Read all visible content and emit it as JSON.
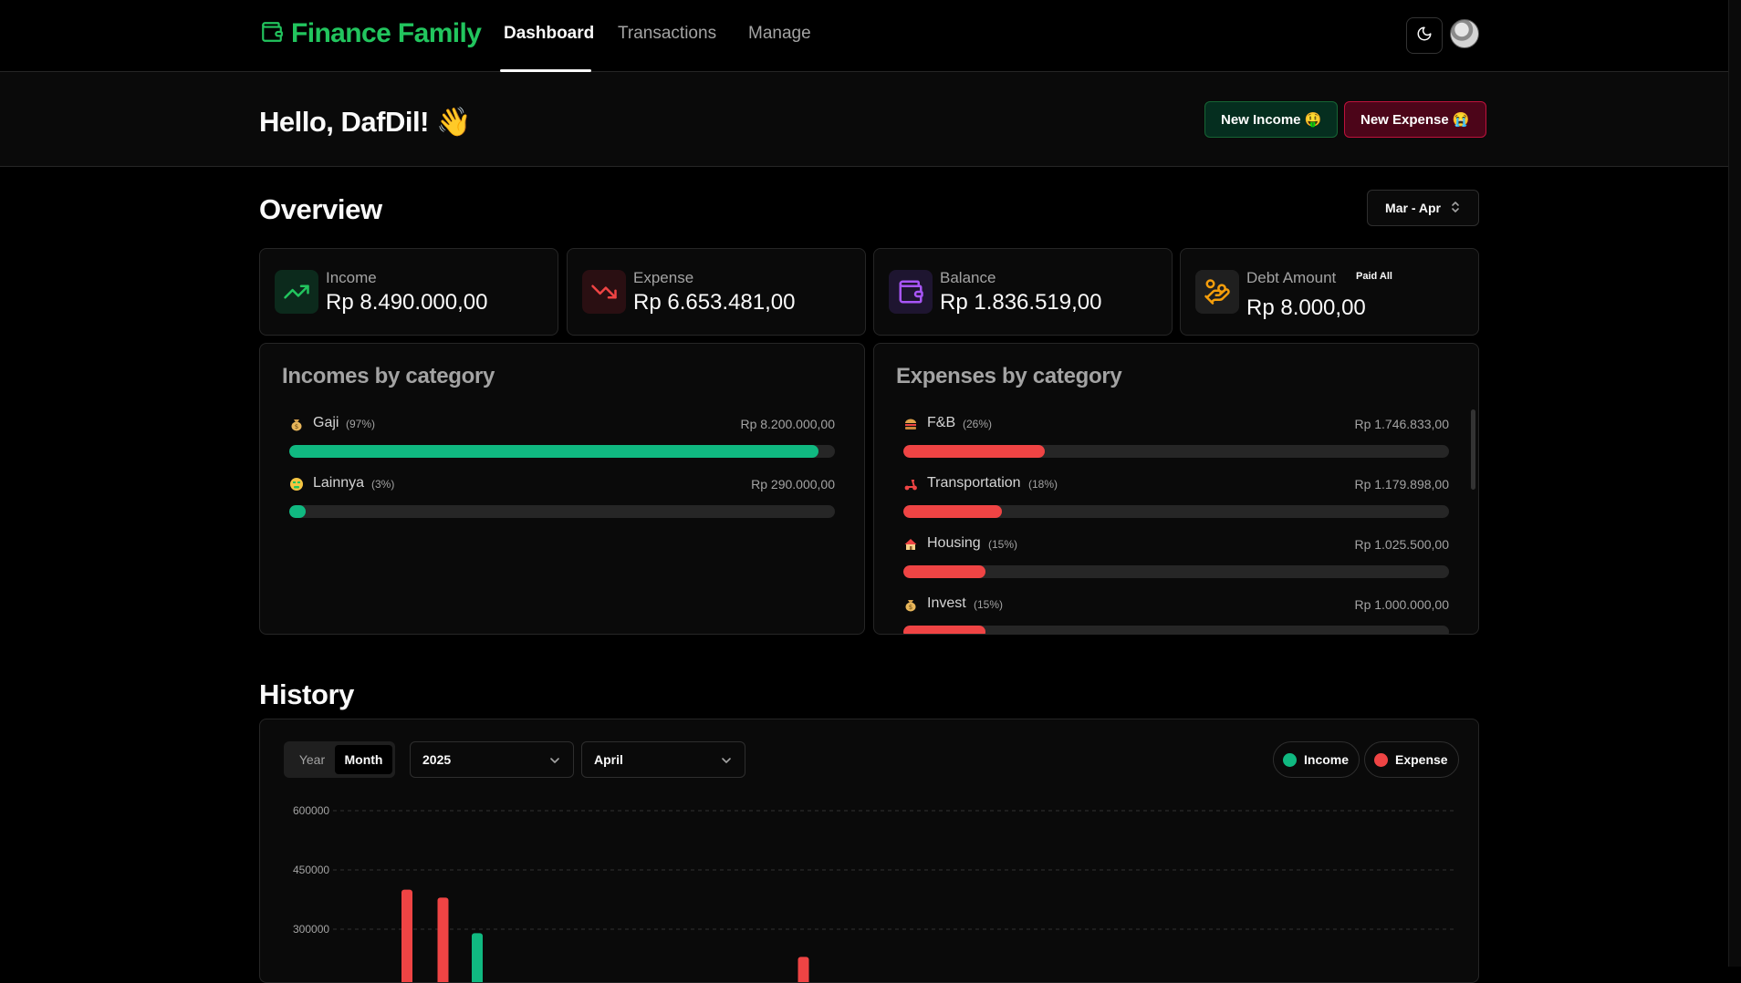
{
  "app": {
    "brand": "Finance Family",
    "nav": [
      {
        "label": "Dashboard",
        "active": true
      },
      {
        "label": "Transactions",
        "active": false
      },
      {
        "label": "Manage",
        "active": false
      }
    ],
    "accent": "#22c55e"
  },
  "greeting": {
    "title": "Hello, DafDil! 👋",
    "new_income": "New Income 🤑",
    "new_expense": "New Expense 😭"
  },
  "overview": {
    "title": "Overview",
    "period": "Mar - Apr",
    "stats": [
      {
        "label": "Income",
        "value": "Rp 8.490.000,00",
        "icon": "trending-up-icon",
        "color": "#22c55e"
      },
      {
        "label": "Expense",
        "value": "Rp 6.653.481,00",
        "icon": "trending-down-icon",
        "color": "#ef4444"
      },
      {
        "label": "Balance",
        "value": "Rp 1.836.519,00",
        "icon": "wallet-icon",
        "color": "#a855f7"
      },
      {
        "label": "Debt Amount",
        "value": "Rp 8.000,00",
        "icon": "hand-coins-icon",
        "color": "#f59e0b",
        "action": "Paid All"
      }
    ]
  },
  "incomes_by_category": {
    "title": "Incomes by category",
    "items": [
      {
        "icon": "money-bag-icon",
        "name": "Gaji",
        "pct": "(97%)",
        "amount": "Rp 8.200.000,00",
        "fraction": 0.97
      },
      {
        "icon": "money-mouth-face-icon",
        "name": "Lainnya",
        "pct": "(3%)",
        "amount": "Rp 290.000,00",
        "fraction": 0.03
      }
    ]
  },
  "expenses_by_category": {
    "title": "Expenses by category",
    "items": [
      {
        "icon": "burger-icon",
        "name": "F&B",
        "pct": "(26%)",
        "amount": "Rp 1.746.833,00",
        "fraction": 0.26
      },
      {
        "icon": "scooter-icon",
        "name": "Transportation",
        "pct": "(18%)",
        "amount": "Rp 1.179.898,00",
        "fraction": 0.18
      },
      {
        "icon": "house-icon",
        "name": "Housing",
        "pct": "(15%)",
        "amount": "Rp 1.025.500,00",
        "fraction": 0.15
      },
      {
        "icon": "money-bag-icon",
        "name": "Invest",
        "pct": "(15%)",
        "amount": "Rp 1.000.000,00",
        "fraction": 0.15
      }
    ]
  },
  "history": {
    "title": "History",
    "mode_year": "Year",
    "mode_month": "Month",
    "year": "2025",
    "month": "April",
    "legend_income": "Income",
    "legend_expense": "Expense"
  },
  "chart_data": {
    "type": "bar",
    "grid": true,
    "ylim": [
      0,
      600000
    ],
    "y_ticks": [
      "600000",
      "450000",
      "300000"
    ],
    "series": [
      {
        "name": "Income",
        "color": "#10b981",
        "x": [
          5
        ],
        "values": [
          290000
        ]
      },
      {
        "name": "Expense",
        "color": "#ef4444",
        "x": [
          3,
          4,
          14
        ],
        "values": [
          400000,
          380000,
          230000
        ]
      }
    ]
  }
}
